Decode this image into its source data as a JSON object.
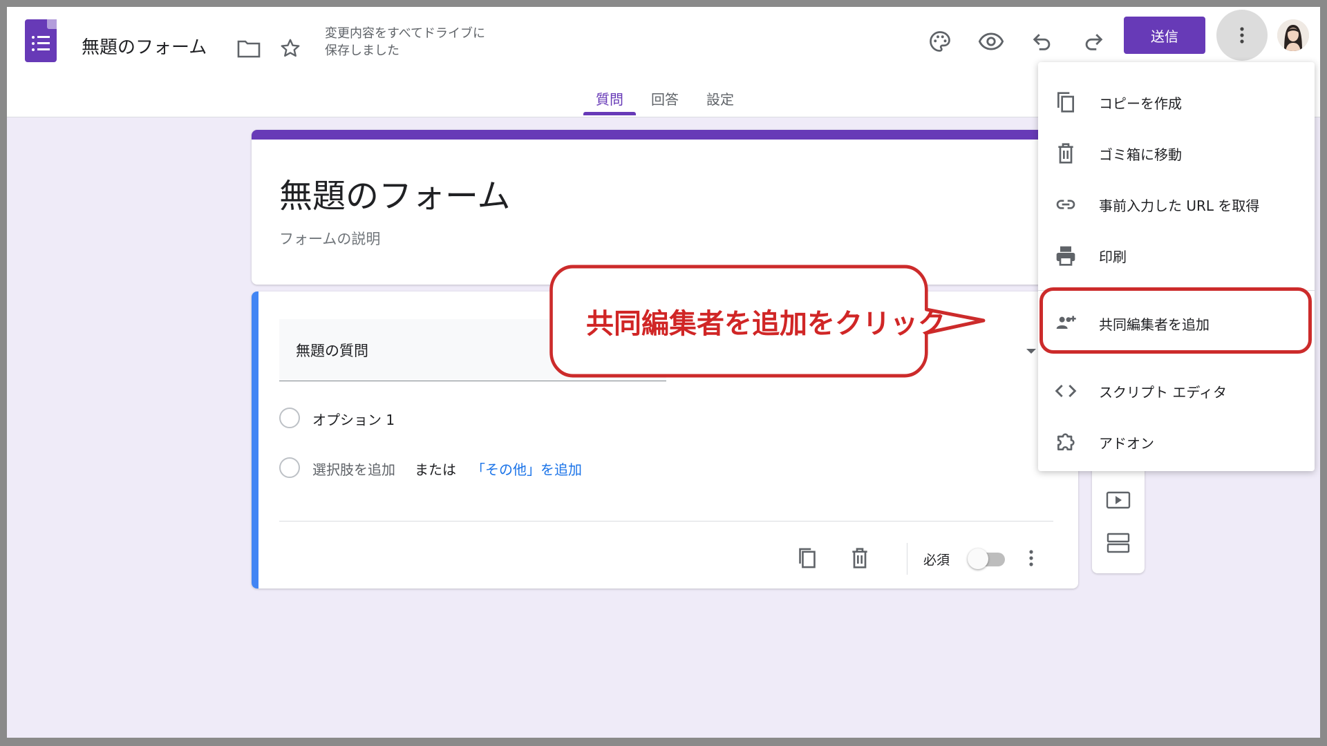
{
  "header": {
    "doc_title": "無題のフォーム",
    "save_status_line1": "変更内容をすべてドライブに",
    "save_status_line2": "保存しました",
    "send_label": "送信"
  },
  "tabs": [
    {
      "label": "質問",
      "active": true
    },
    {
      "label": "回答",
      "active": false
    },
    {
      "label": "設定",
      "active": false
    }
  ],
  "form": {
    "title": "無題のフォーム",
    "description": "フォームの説明"
  },
  "question": {
    "title": "無題の質問",
    "option1": "オプション 1",
    "add_option": "選択肢を追加",
    "or": "または",
    "add_other": "「その他」を追加",
    "required_label": "必須",
    "required": false
  },
  "menu": {
    "items": [
      {
        "label": "コピーを作成",
        "icon": "copy-icon"
      },
      {
        "label": "ゴミ箱に移動",
        "icon": "trash-icon"
      },
      {
        "label": "事前入力した URL を取得",
        "icon": "link-icon"
      },
      {
        "label": "印刷",
        "icon": "print-icon"
      },
      {
        "label": "共同編集者を追加",
        "icon": "add-people-icon"
      },
      {
        "label": "スクリプト エディタ",
        "icon": "code-icon"
      },
      {
        "label": "アドオン",
        "icon": "puzzle-icon"
      }
    ]
  },
  "annotation": {
    "callout_text": "共同編集者を追加をクリック",
    "color": "#d02626"
  },
  "colors": {
    "brand": "#673ab7",
    "background": "#efebf8",
    "question_accent": "#4285f4",
    "link": "#1a73e8"
  }
}
